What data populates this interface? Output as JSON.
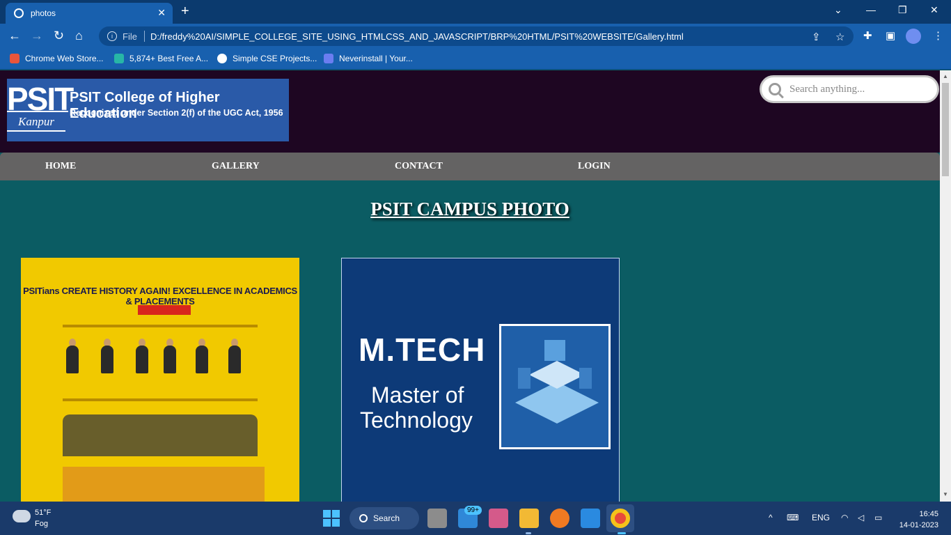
{
  "browser": {
    "tab_title": "photos",
    "url_scheme": "File",
    "url": "D:/freddy%20AI/SIMPLE_COLLEGE_SITE_USING_HTMLCSS_AND_JAVASCRIPT/BRP%20HTML/PSIT%20WEBSITE/Gallery.html",
    "bookmarks": [
      {
        "label": "Chrome Web Store...",
        "icon": "store-icon"
      },
      {
        "label": "5,874+ Best Free A...",
        "icon": "bookmark-d-icon"
      },
      {
        "label": "Simple CSE Projects...",
        "icon": "globe-icon"
      },
      {
        "label": "Neverinstall | Your...",
        "icon": "neverinstall-icon"
      }
    ]
  },
  "site": {
    "logo": {
      "short": "PSIT",
      "city": "Kanpur",
      "college": "PSIT College of Higher Education",
      "recognition": "Recognized under Section 2(f) of the UGC Act, 1956"
    },
    "search_placeholder": "Search anything...",
    "nav": [
      "HOME",
      "GALLERY",
      "CONTACT",
      "LOGIN"
    ],
    "page_title": "PSIT CAMPUS PHOTO",
    "photos": [
      {
        "headline": "PSITians CREATE HISTORY AGAIN! EXCELLENCE IN ACADEMICS & PLACEMENTS",
        "colors": {
          "bg": "#f1c900"
        }
      },
      {
        "headline": "M.TECH",
        "line1": "Master of",
        "line2": "Technology",
        "colors": {
          "bg": "#0d3a78"
        }
      }
    ]
  },
  "taskbar": {
    "temperature": "51°F",
    "condition": "Fog",
    "search_label": "Search",
    "mail_badge": "99+",
    "language": "ENG",
    "time": "16:45",
    "date": "14-01-2023"
  }
}
